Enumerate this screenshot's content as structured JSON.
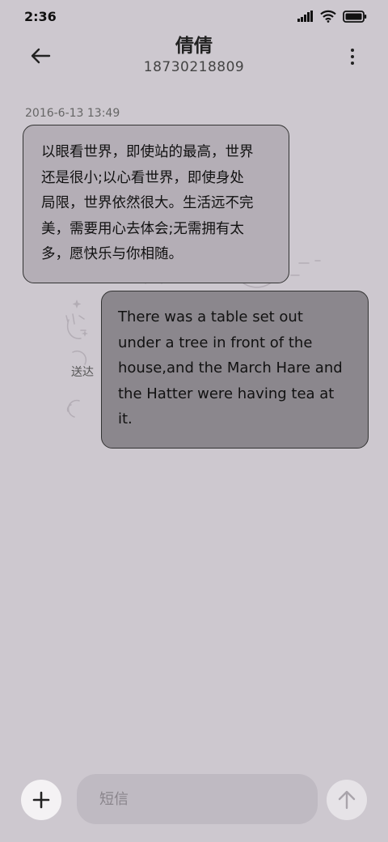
{
  "status_bar": {
    "time": "2:36"
  },
  "header": {
    "contact_name": "倩倩",
    "contact_number": "18730218809"
  },
  "conversation": {
    "timestamp": "2016-6-13 13:49",
    "messages": [
      {
        "direction": "incoming",
        "lines": [
          "以眼看世界，即使站的最高，世界",
          "还是很小;以心看世界，即使身处",
          "局限，世界依然很大。生活远不完",
          "美，需要用心去体会;无需拥有太",
          "多，愿快乐与你相随。"
        ]
      },
      {
        "direction": "outgoing",
        "lines": [
          "There was a table set out",
          "under a tree in front of the",
          "house,and the March Hare and",
          "the Hatter were having tea at",
          "it."
        ],
        "status": "送达"
      }
    ]
  },
  "composer": {
    "placeholder": "短信"
  },
  "icons": {
    "back": "arrow-left-icon",
    "more": "more-vertical-icon",
    "add": "plus-icon",
    "send": "arrow-up-icon"
  },
  "colors": {
    "background": "#cdc8cf",
    "incoming_bubble": "#b4aeb6",
    "outgoing_bubble": "#8b878d"
  }
}
